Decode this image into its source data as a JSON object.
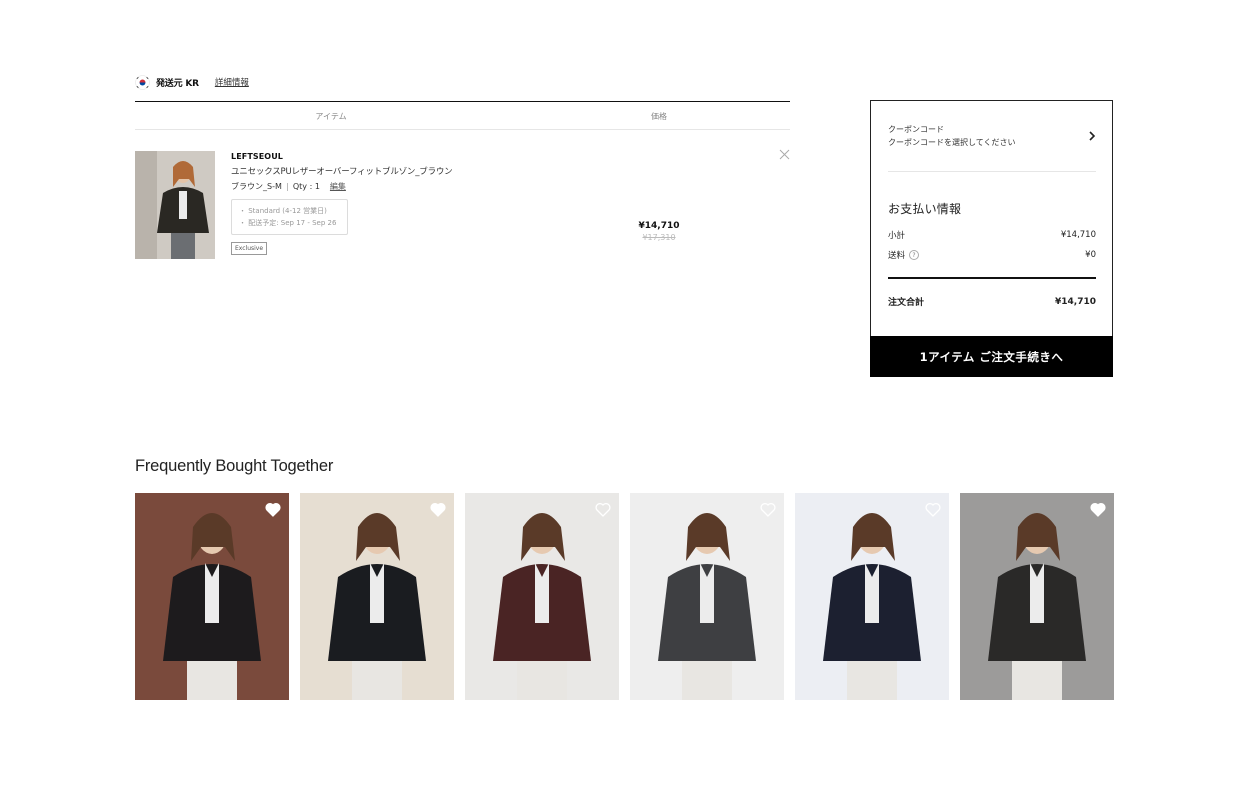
{
  "origin": {
    "label": "発送元 KR",
    "details_link": "詳細情報",
    "flag_icon": "korea-flag-icon"
  },
  "cart": {
    "columns": {
      "item": "アイテム",
      "price": "価格"
    },
    "items": [
      {
        "brand": "LEFTSEOUL",
        "name": "ユニセックスPUレザーオーバーフィットブルゾン_ブラウン",
        "variant": "ブラウン_S-M",
        "qty": "Qty : 1",
        "change_link": "編集",
        "shipping_method": "・ Standard (4-12 営業日)",
        "delivery_estimate": "・ 配送予定: Sep 17 - Sep 26",
        "badge": "Exclusive",
        "price": "¥14,710",
        "original_price": "¥17,310"
      }
    ]
  },
  "summary": {
    "coupon_title": "クーポンコード",
    "coupon_prompt": "クーポンコードを選択してください",
    "payment_title": "お支払い情報",
    "subtotal_label": "小計",
    "subtotal_value": "¥14,710",
    "shipping_label": "送料",
    "shipping_value": "¥0",
    "total_label": "注文合計",
    "total_value": "¥14,710",
    "checkout_button": "1アイテム ご注文手続きへ"
  },
  "recommendations": {
    "title": "Frequently Bought Together",
    "products": [
      {
        "jacket_color": "#1d1b1d",
        "bg": "#7a4a3c",
        "liked": true
      },
      {
        "jacket_color": "#1a1c20",
        "bg": "#e6ded2",
        "liked": true
      },
      {
        "jacket_color": "#4a2424",
        "bg": "#e9e8e6",
        "liked": false
      },
      {
        "jacket_color": "#3e3f42",
        "bg": "#eeeeee",
        "liked": false
      },
      {
        "jacket_color": "#1c2030",
        "bg": "#eceef3",
        "liked": false
      },
      {
        "jacket_color": "#2a2928",
        "bg": "#9c9b9a",
        "liked": true
      }
    ]
  }
}
